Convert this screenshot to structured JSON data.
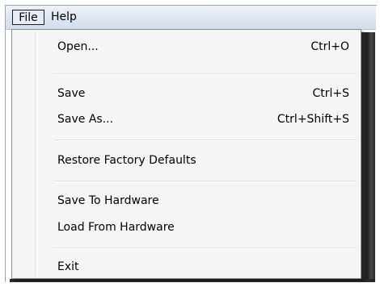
{
  "menubar": {
    "file_label": "File",
    "help_label": "Help"
  },
  "file_menu": {
    "items": [
      {
        "label": "Open...",
        "shortcut": "Ctrl+O"
      },
      {
        "label": "Save",
        "shortcut": "Ctrl+S"
      },
      {
        "label": "Save As...",
        "shortcut": "Ctrl+Shift+S"
      },
      {
        "label": "Restore Factory Defaults",
        "shortcut": ""
      },
      {
        "label": "Save To Hardware",
        "shortcut": ""
      },
      {
        "label": "Load From Hardware",
        "shortcut": ""
      },
      {
        "label": "Exit",
        "shortcut": ""
      }
    ]
  }
}
